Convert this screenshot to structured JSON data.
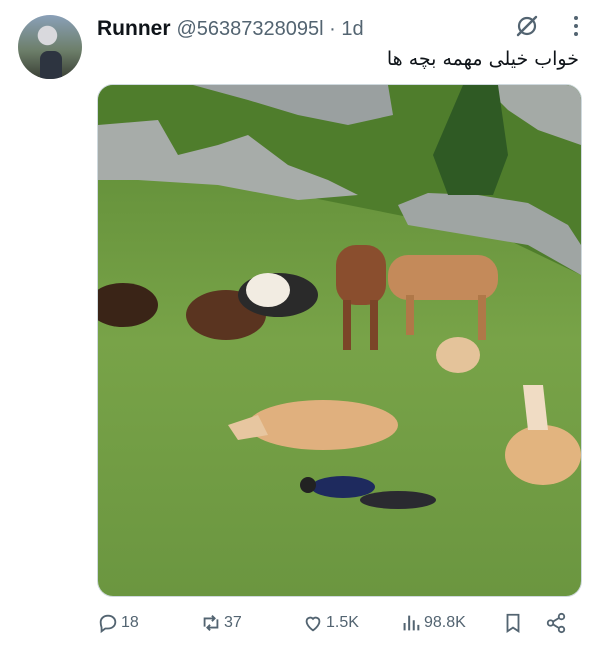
{
  "tweet": {
    "author_name": "Runner",
    "handle_line": "@56387328095l · 1d",
    "text": "خواب خیلی مهمه بچه ها"
  },
  "media": {
    "description_icon": "photo"
  },
  "actions": {
    "replies": "18",
    "reposts": "37",
    "likes": "1.5K",
    "views": "98.8K"
  },
  "colors": {
    "text_primary": "#0f1419",
    "text_secondary": "#536471",
    "grass": "#6f9a3e"
  }
}
